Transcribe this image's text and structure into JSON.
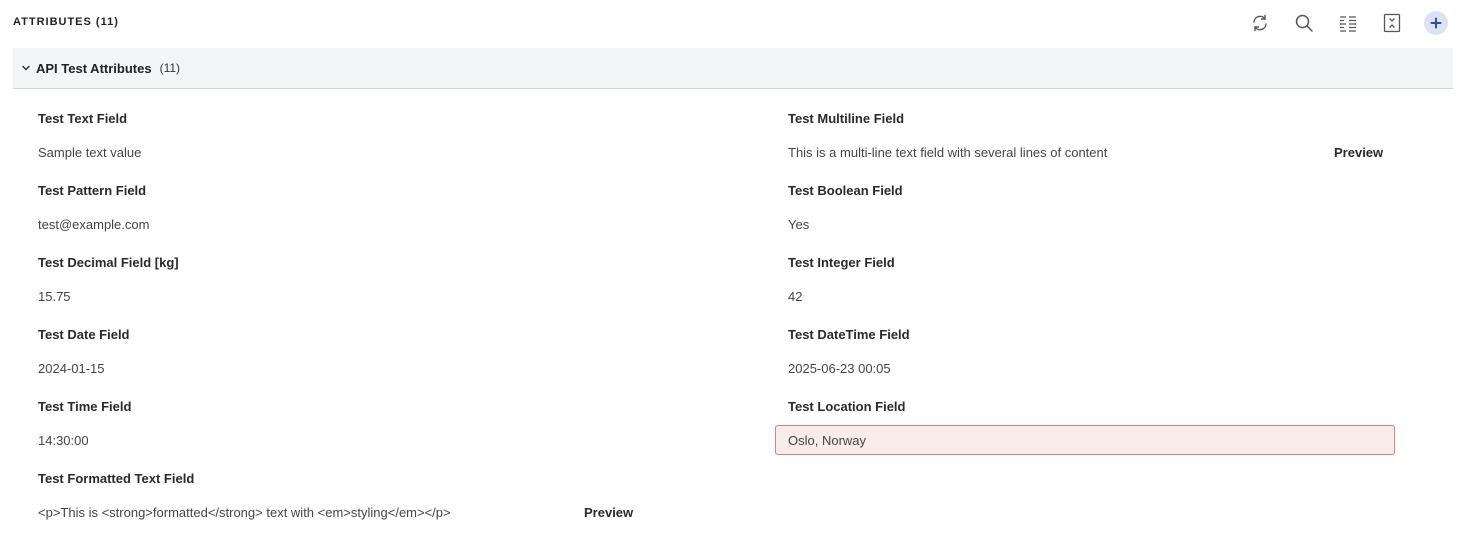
{
  "header": {
    "title": "ATTRIBUTES (11)",
    "tools": {
      "refresh": "refresh-icon",
      "search": "search-icon",
      "list": "list-view-icon",
      "collapse": "collapse-icon",
      "add": "add-icon"
    }
  },
  "group": {
    "title": "API Test Attributes",
    "count": "(11)"
  },
  "fields": {
    "text": {
      "label": "Test Text Field",
      "value": "Sample text value"
    },
    "multiline": {
      "label": "Test Multiline Field",
      "value": "This is a multi-line text field with several lines of content",
      "action": "Preview"
    },
    "pattern": {
      "label": "Test Pattern Field",
      "value": "test@example.com"
    },
    "boolean": {
      "label": "Test Boolean Field",
      "value": "Yes"
    },
    "decimal": {
      "label": "Test Decimal Field [kg]",
      "value": "15.75"
    },
    "integer": {
      "label": "Test Integer Field",
      "value": "42"
    },
    "date": {
      "label": "Test Date Field",
      "value": "2024-01-15"
    },
    "datetime": {
      "label": "Test DateTime Field",
      "value": "2025-06-23 00:05"
    },
    "time": {
      "label": "Test Time Field",
      "value": "14:30:00"
    },
    "location": {
      "label": "Test Location Field",
      "value": "Oslo, Norway"
    },
    "formatted": {
      "label": "Test Formatted Text Field",
      "value": "<p>This is <strong>formatted</strong> text with <em>styling</em></p>",
      "action": "Preview"
    }
  },
  "colors": {
    "accent": "#2c4fa3",
    "highlight_bg": "#f9ecea",
    "highlight_border": "#d9807a"
  }
}
